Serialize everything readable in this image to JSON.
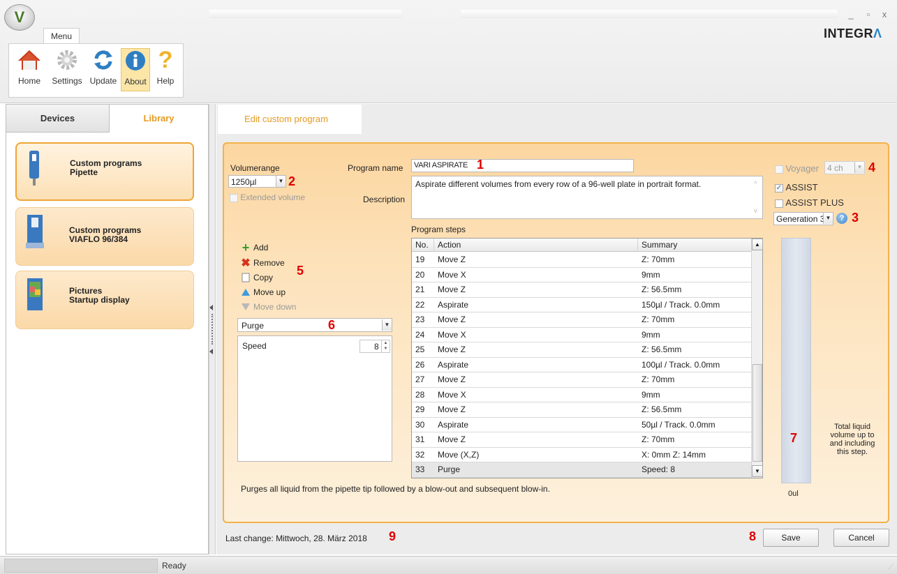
{
  "window": {
    "logo_letter": "V",
    "menu_tab": "Menu",
    "brand_main": "INTEGR",
    "brand_accent": "Λ",
    "minimize": "_",
    "maximize": "▫",
    "close": "x"
  },
  "ribbon": {
    "items": [
      {
        "label": "Home",
        "icon": "home-icon"
      },
      {
        "label": "Settings",
        "icon": "gear-icon"
      },
      {
        "label": "Update",
        "icon": "sync-icon"
      },
      {
        "label": "About",
        "icon": "info-icon",
        "active": true
      },
      {
        "label": "Help",
        "icon": "question-icon"
      }
    ]
  },
  "left": {
    "tabs": [
      {
        "label": "Devices"
      },
      {
        "label": "Library",
        "active": true
      }
    ],
    "cards": [
      {
        "line1": "Custom programs",
        "line2": "Pipette",
        "selected": true
      },
      {
        "line1": "Custom programs",
        "line2": "VIAFLO 96/384"
      },
      {
        "line1": "Pictures",
        "line2": "Startup display"
      }
    ]
  },
  "editor": {
    "tab_label": "Edit custom program",
    "volumerange_label": "Volumerange",
    "volumerange_value": "1250µl",
    "extended_volume": "Extended volume",
    "program_name_label": "Program name",
    "program_name_value": "VARI ASPIRATE",
    "description_label": "Description",
    "description_value": "Aspirate different volumes from every row of a 96-well plate in portrait format.",
    "voyager_label": "Voyager",
    "voyager_channels": "4 ch",
    "assist_label": "ASSIST",
    "assist_plus_label": "ASSIST PLUS",
    "generation_value": "Generation 3",
    "program_steps_label": "Program steps",
    "columns": {
      "no": "No.",
      "action": "Action",
      "summary": "Summary"
    },
    "steps": [
      {
        "no": "19",
        "action": "Move Z",
        "summary": "Z: 70mm"
      },
      {
        "no": "20",
        "action": "Move X",
        "summary": "9mm"
      },
      {
        "no": "21",
        "action": "Move Z",
        "summary": "Z: 56.5mm"
      },
      {
        "no": "22",
        "action": "Aspirate",
        "summary": "150µl / Track. 0.0mm"
      },
      {
        "no": "23",
        "action": "Move Z",
        "summary": "Z: 70mm"
      },
      {
        "no": "24",
        "action": "Move X",
        "summary": "9mm"
      },
      {
        "no": "25",
        "action": "Move Z",
        "summary": "Z: 56.5mm"
      },
      {
        "no": "26",
        "action": "Aspirate",
        "summary": "100µl / Track. 0.0mm"
      },
      {
        "no": "27",
        "action": "Move Z",
        "summary": "Z: 70mm"
      },
      {
        "no": "28",
        "action": "Move X",
        "summary": "9mm"
      },
      {
        "no": "29",
        "action": "Move Z",
        "summary": "Z: 56.5mm"
      },
      {
        "no": "30",
        "action": "Aspirate",
        "summary": "50µl / Track. 0.0mm"
      },
      {
        "no": "31",
        "action": "Move Z",
        "summary": "Z: 70mm"
      },
      {
        "no": "32",
        "action": "Move (X,Z)",
        "summary": "X: 0mm Z: 14mm"
      },
      {
        "no": "33",
        "action": "Purge",
        "summary": "Speed: 8",
        "selected": true
      }
    ],
    "actions": {
      "add": "Add",
      "remove": "Remove",
      "copy": "Copy",
      "move_up": "Move up",
      "move_down": "Move down"
    },
    "step_type_value": "Purge",
    "param_label": "Speed",
    "param_value": "8",
    "volume_caption": "Total liquid volume up to and including this step.",
    "volume_value": "0ul",
    "step_description": "Purges all liquid from the pipette tip followed by a blow-out and subsequent blow-in.",
    "last_change_label": "Last change:",
    "last_change_value": "Mittwoch, 28. März 2018",
    "save": "Save",
    "cancel": "Cancel"
  },
  "annotations": {
    "n1": "1",
    "n2": "2",
    "n3": "3",
    "n4": "4",
    "n5": "5",
    "n6": "6",
    "n7": "7",
    "n8": "8",
    "n9": "9"
  },
  "status": {
    "text": "Ready"
  },
  "colors": {
    "accent_orange": "#f4b14a",
    "tab_orange_text": "#e79a22",
    "annotation_red": "#e00000",
    "brand_blue": "#2b86c4"
  }
}
